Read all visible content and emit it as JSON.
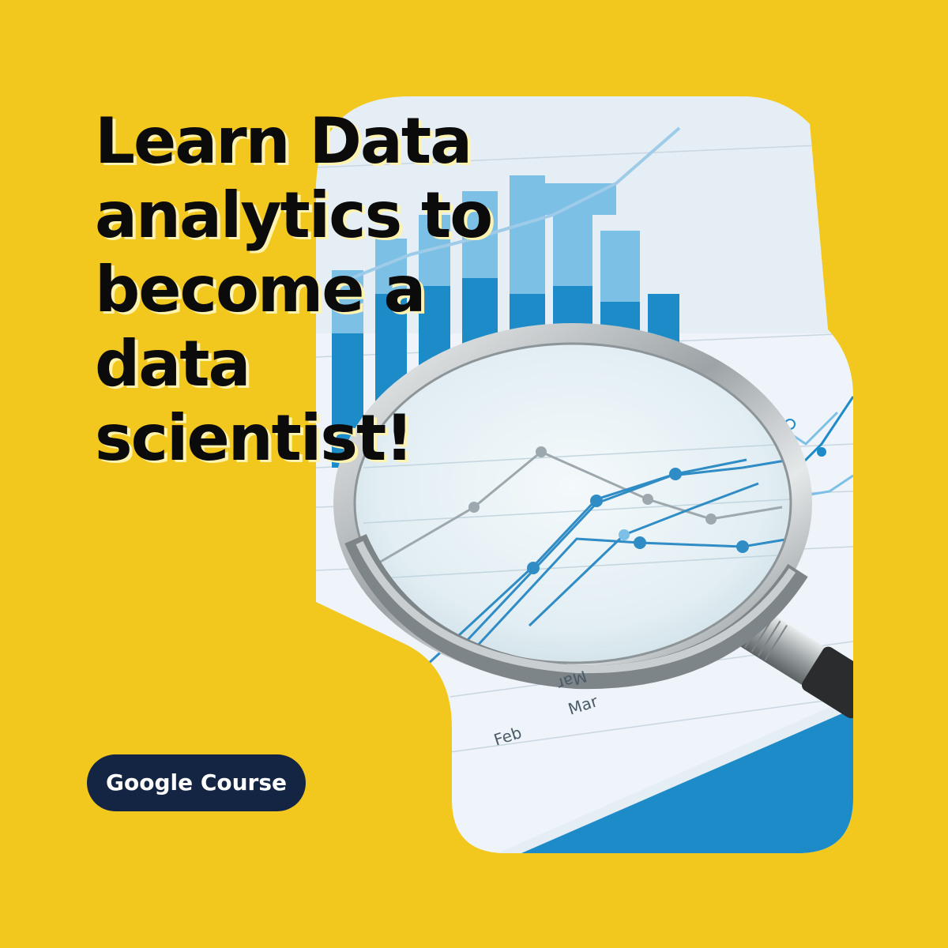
{
  "headline": {
    "line1": "Learn Data",
    "line2": "analytics to",
    "line3": "become a",
    "line4": "data",
    "line5": "scientist!"
  },
  "badge": {
    "label": "Google Course"
  },
  "photo": {
    "subject": "magnifying-glass-over-charts",
    "month_labels": [
      "Feb",
      "Mar",
      "Mar"
    ],
    "colors": {
      "bar_blue": "#1E8BC9",
      "light_blue": "#7CC0E6",
      "paper": "#EEF4F9",
      "background": "#F2C81E",
      "badge": "#142544"
    }
  }
}
